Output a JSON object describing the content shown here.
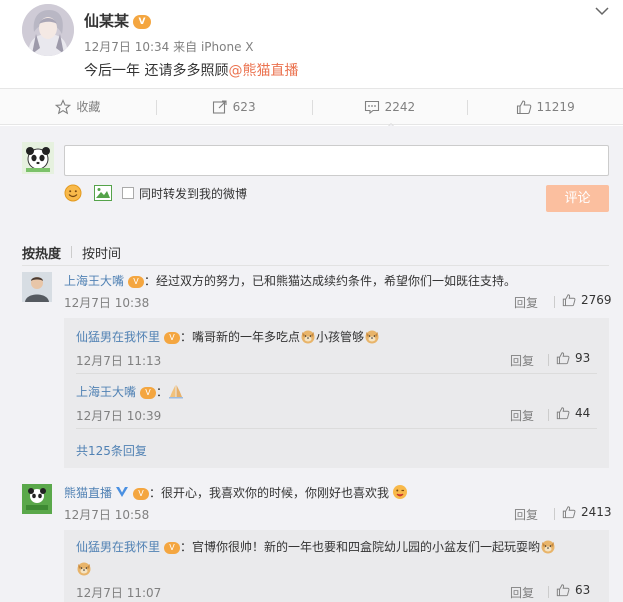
{
  "post": {
    "author": "仙某某",
    "vip_badge": "V",
    "time": "12月7日 10:34",
    "source": "来自 iPhone X",
    "text": "今后一年 还请多多照顾",
    "mention": "@熊猫直播"
  },
  "actions": {
    "favorite": "收藏",
    "repost": "623",
    "comment": "2242",
    "like": "11219"
  },
  "composer": {
    "placeholder": "",
    "repost_label": "同时转发到我的微博",
    "submit_label": "评论"
  },
  "sort": {
    "hot": "按热度",
    "time": "按时间"
  },
  "comments": [
    {
      "name": "上海王大嘴",
      "text": "：经过双方的努力，已和熊猫达成续约条件，希望你们一如既往支持。",
      "time": "12月7日 10:38",
      "reply": "回复",
      "likes": "2769",
      "subs": [
        {
          "name": "仙猛男在我怀里",
          "text": "：嘴哥新的一年多吃点",
          "text2": "小孩管够",
          "time": "12月7日 11:13",
          "reply": "回复",
          "likes": "93"
        },
        {
          "name": "上海王大嘴",
          "text": "：",
          "time": "12月7日 10:39",
          "reply": "回复",
          "likes": "44"
        }
      ],
      "more": "共125条回复"
    },
    {
      "name": "熊猫直播",
      "text": "：很开心，我喜欢你的时候，你刚好也喜欢我",
      "time": "12月7日 10:58",
      "reply": "回复",
      "likes": "2413",
      "subs": [
        {
          "name": "仙猛男在我怀里",
          "text": "：官博你很帅！新的一年也要和四盒院幼儿园的小盆友们一起玩耍哟",
          "time": "12月7日 11:07",
          "reply": "回复",
          "likes": "63"
        }
      ]
    }
  ],
  "colors": {
    "accent": "#eb7350",
    "link": "#5182b4",
    "submit_bg": "#fbbf9f",
    "panel_bg": "#f2f2f5",
    "sub_bg": "#eaeaec"
  }
}
